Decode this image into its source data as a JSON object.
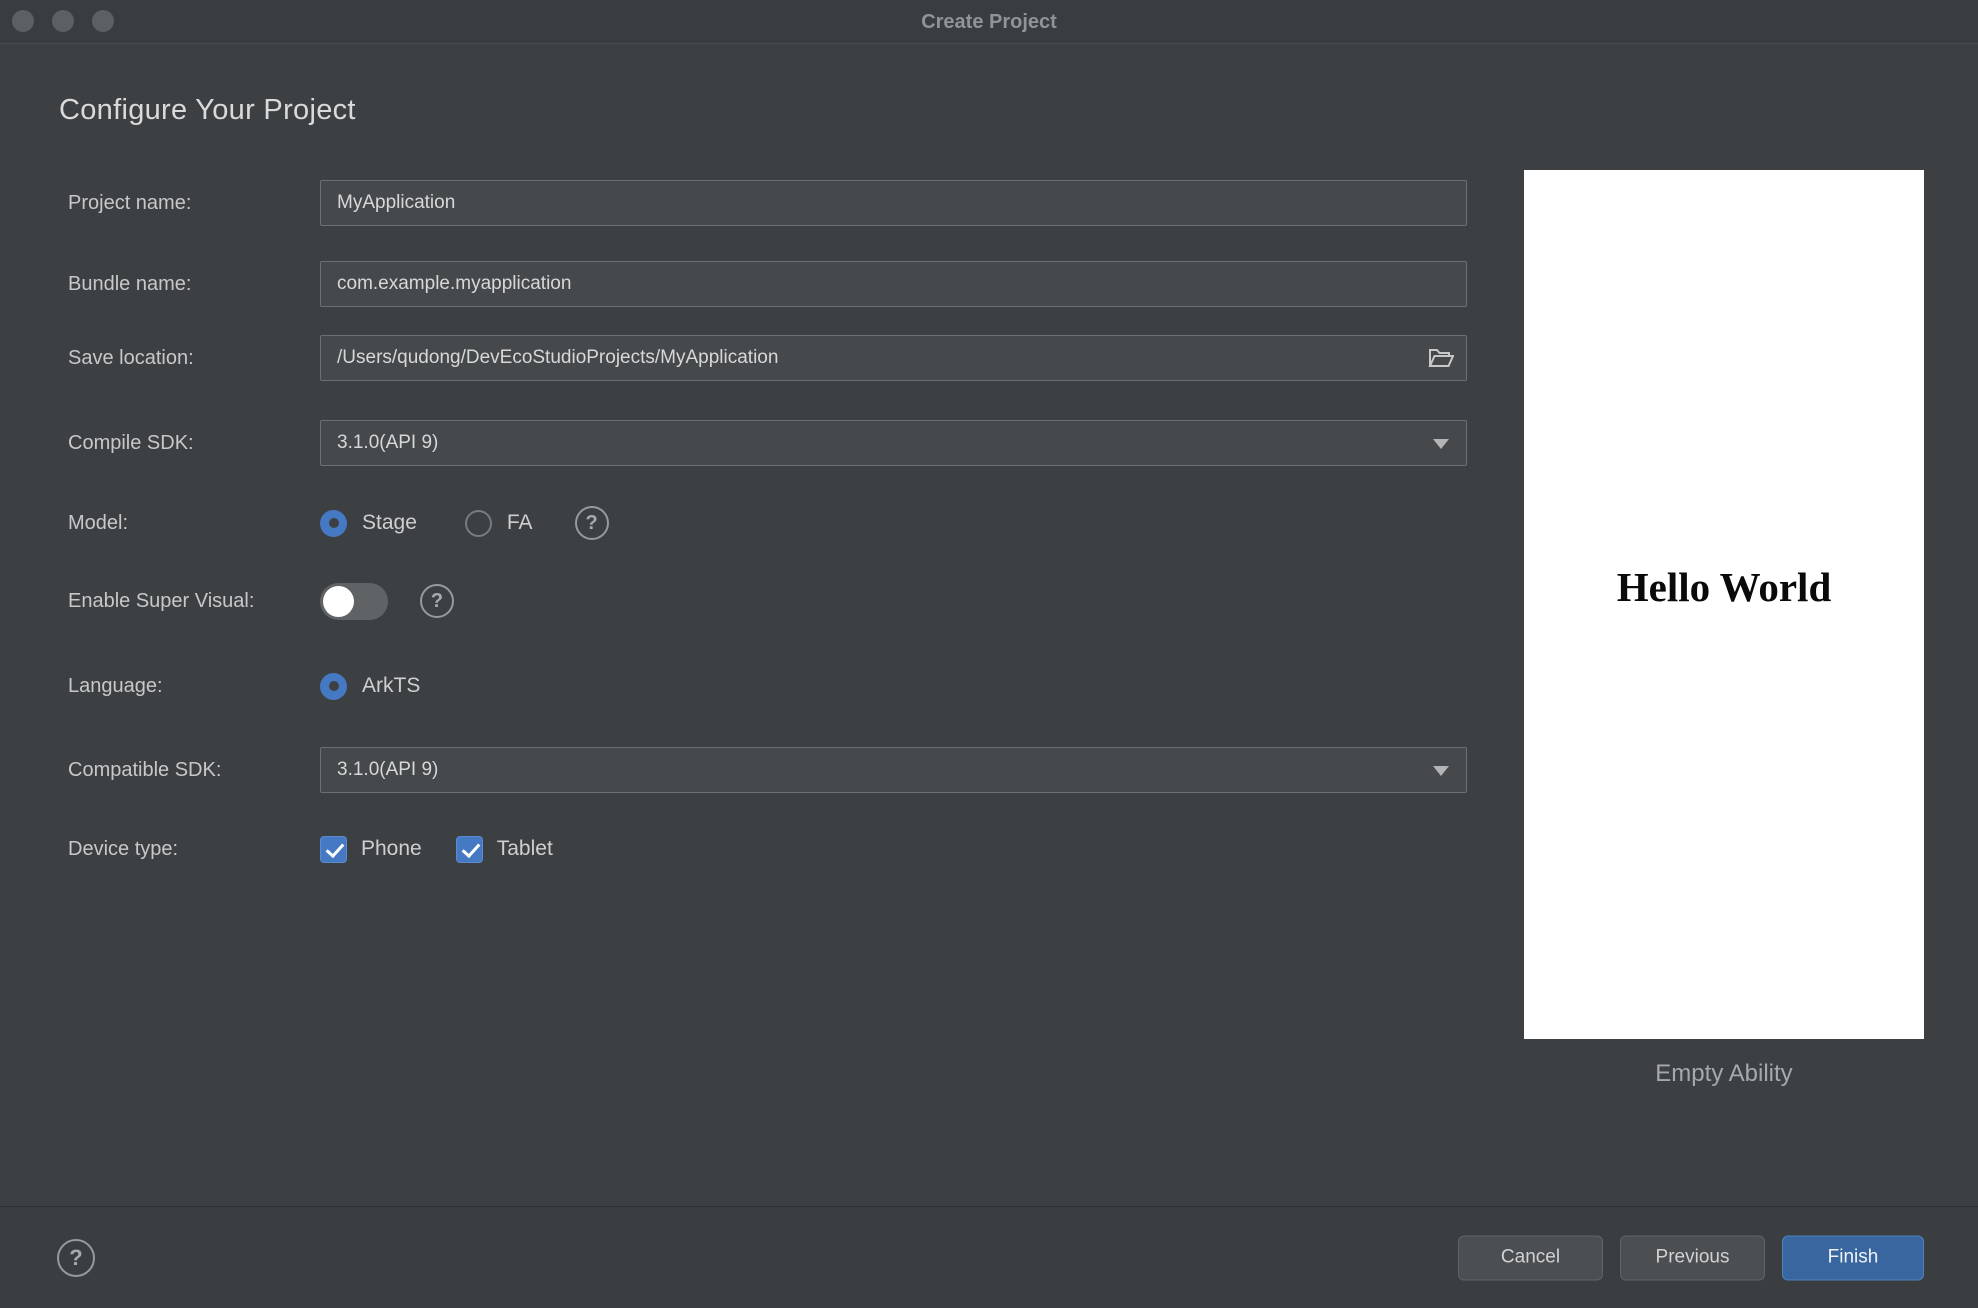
{
  "window": {
    "title": "Create Project"
  },
  "header": {
    "title": "Configure Your Project"
  },
  "form": {
    "project_name": {
      "label": "Project name:",
      "value": "MyApplication"
    },
    "bundle_name": {
      "label": "Bundle name:",
      "value": "com.example.myapplication"
    },
    "save_location": {
      "label": "Save location:",
      "value": "/Users/qudong/DevEcoStudioProjects/MyApplication"
    },
    "compile_sdk": {
      "label": "Compile SDK:",
      "value": "3.1.0(API 9)"
    },
    "model": {
      "label": "Model:",
      "options": [
        {
          "label": "Stage",
          "selected": true
        },
        {
          "label": "FA",
          "selected": false
        }
      ]
    },
    "enable_super_visual": {
      "label": "Enable Super Visual:",
      "enabled": false
    },
    "language": {
      "label": "Language:",
      "options": [
        {
          "label": "ArkTS",
          "selected": true
        }
      ]
    },
    "compatible_sdk": {
      "label": "Compatible SDK:",
      "value": "3.1.0(API 9)"
    },
    "device_type": {
      "label": "Device type:",
      "options": [
        {
          "label": "Phone",
          "checked": true
        },
        {
          "label": "Tablet",
          "checked": true
        }
      ]
    }
  },
  "icons": {
    "question_glyph": "?",
    "folder_icon": "open-folder",
    "dropdown_caret": "chevron-down"
  },
  "preview": {
    "screen_text": "Hello World",
    "caption": "Empty Ability"
  },
  "footer": {
    "cancel_label": "Cancel",
    "previous_label": "Previous",
    "finish_label": "Finish"
  },
  "colors": {
    "dialog_background": "#3d4043",
    "field_background": "#45494b",
    "field_border": "#6d7072",
    "accent_blue": "#4679c4",
    "finish_button_blue": "#3a66a0",
    "preview_background": "#ffffff",
    "text_primary": "#d6d8da",
    "text_label": "#c6c8ca"
  }
}
